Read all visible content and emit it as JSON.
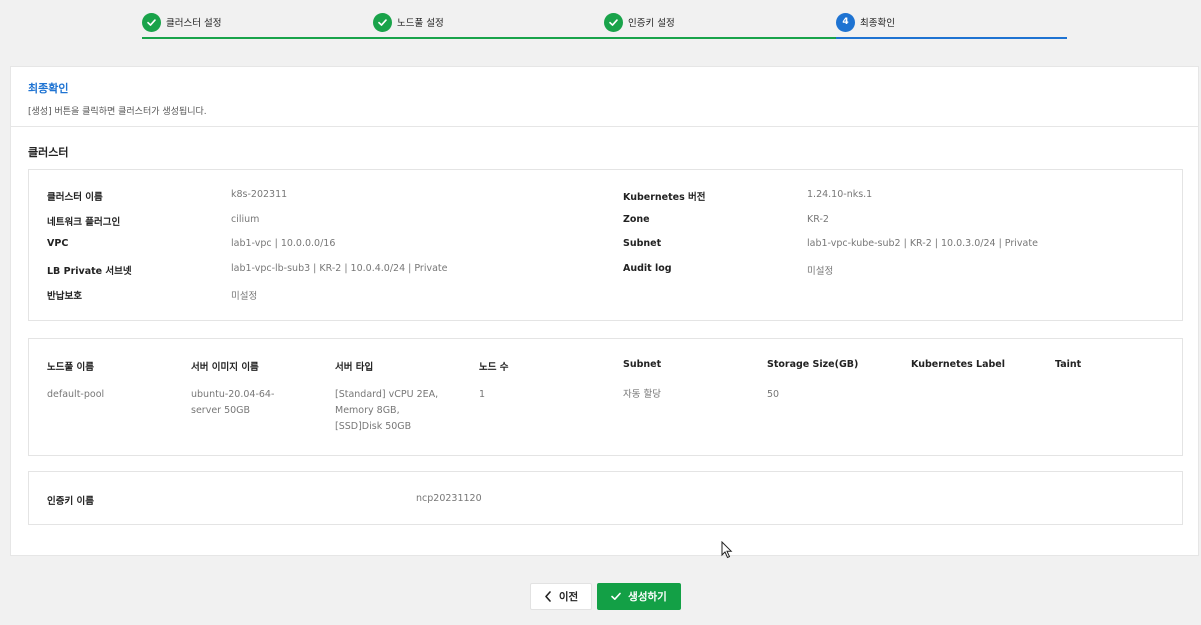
{
  "stepper": {
    "steps": [
      {
        "label": "클러스터 설정",
        "status": "done"
      },
      {
        "label": "노드풀 설정",
        "status": "done"
      },
      {
        "label": "인증키 설정",
        "status": "done"
      },
      {
        "label": "최종확인",
        "status": "active",
        "number": "4"
      }
    ]
  },
  "header": {
    "title": "최종확인",
    "description": "[생성] 버튼을 클릭하면 클러스터가 생성됩니다."
  },
  "cluster": {
    "section_title": "클러스터",
    "left": [
      {
        "key": "클러스터 이름",
        "value": "k8s-202311"
      },
      {
        "key": "네트워크 플러그인",
        "value": "cilium"
      },
      {
        "key": "VPC",
        "value": "lab1-vpc | 10.0.0.0/16"
      },
      {
        "key": "LB Private 서브넷",
        "value": "lab1-vpc-lb-sub3 | KR-2 | 10.0.4.0/24 | Private"
      },
      {
        "key": "반납보호",
        "value": "미설정"
      }
    ],
    "right": [
      {
        "key": "Kubernetes 버전",
        "value": "1.24.10-nks.1"
      },
      {
        "key": "Zone",
        "value": "KR-2"
      },
      {
        "key": "Subnet",
        "value": "lab1-vpc-kube-sub2 | KR-2 | 10.0.3.0/24 | Private"
      },
      {
        "key": "Audit log",
        "value": "미설정"
      }
    ]
  },
  "nodepool": {
    "headers": [
      "노드풀 이름",
      "서버 이미지 이름",
      "서버 타입",
      "노드 수",
      "Subnet",
      "Storage Size(GB)",
      "Kubernetes Label",
      "Taint"
    ],
    "row": {
      "name": "default-pool",
      "image_line1": "ubuntu-20.04-64-",
      "image_line2": "server 50GB",
      "type_line1": "[Standard] vCPU 2EA,",
      "type_line2": "Memory 8GB,",
      "type_line3": "[SSD]Disk 50GB",
      "count": "1",
      "subnet": "자동 할당",
      "storage": "50",
      "label": "",
      "taint": ""
    }
  },
  "authkey": {
    "label": "인증키 이름",
    "value": "ncp20231120"
  },
  "buttons": {
    "prev": "이전",
    "create": "생성하기"
  },
  "colors": {
    "done": "#19a34a",
    "active": "#1e73d2",
    "primary_button": "#13a046"
  }
}
